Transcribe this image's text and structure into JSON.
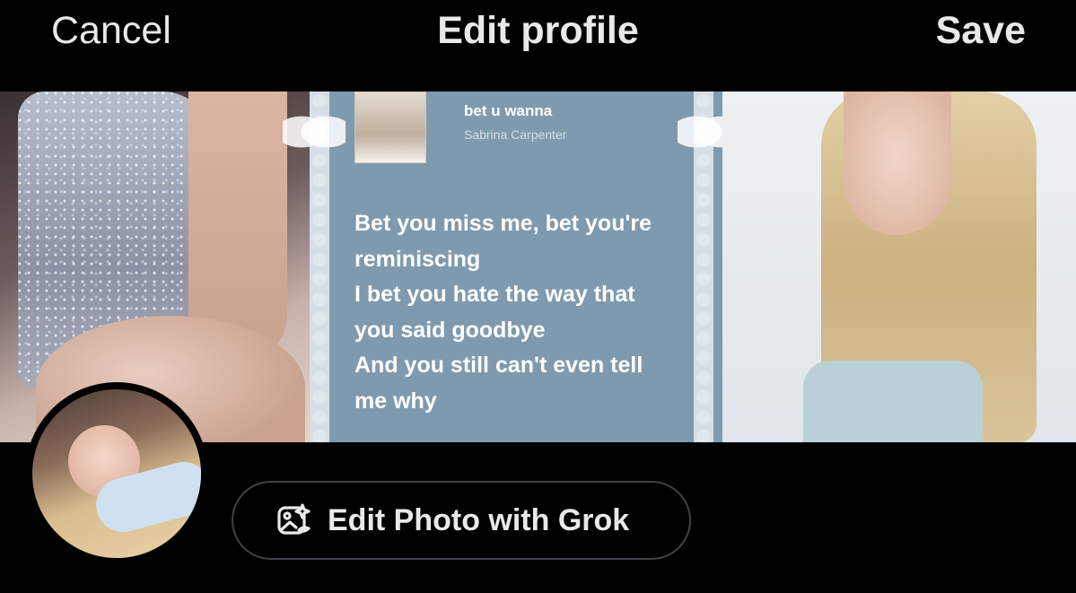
{
  "header": {
    "cancel_label": "Cancel",
    "title": "Edit profile",
    "save_label": "Save"
  },
  "banner": {
    "song_title": "bet u wanna",
    "song_artist": "Sabrina Carpenter",
    "lyrics": [
      "Bet you miss me, bet you're",
      "reminiscing",
      "I bet you hate the way that",
      "you said goodbye",
      "And you still can't even tell",
      "me why"
    ]
  },
  "actions": {
    "edit_photo_label": "Edit Photo with Grok",
    "edit_photo_icon": "image-sparkle-icon"
  },
  "colors": {
    "background": "#000000",
    "text": "#e7e9ea",
    "button_border": "#3f4347",
    "lyrics_panel": "#7f9aae"
  }
}
